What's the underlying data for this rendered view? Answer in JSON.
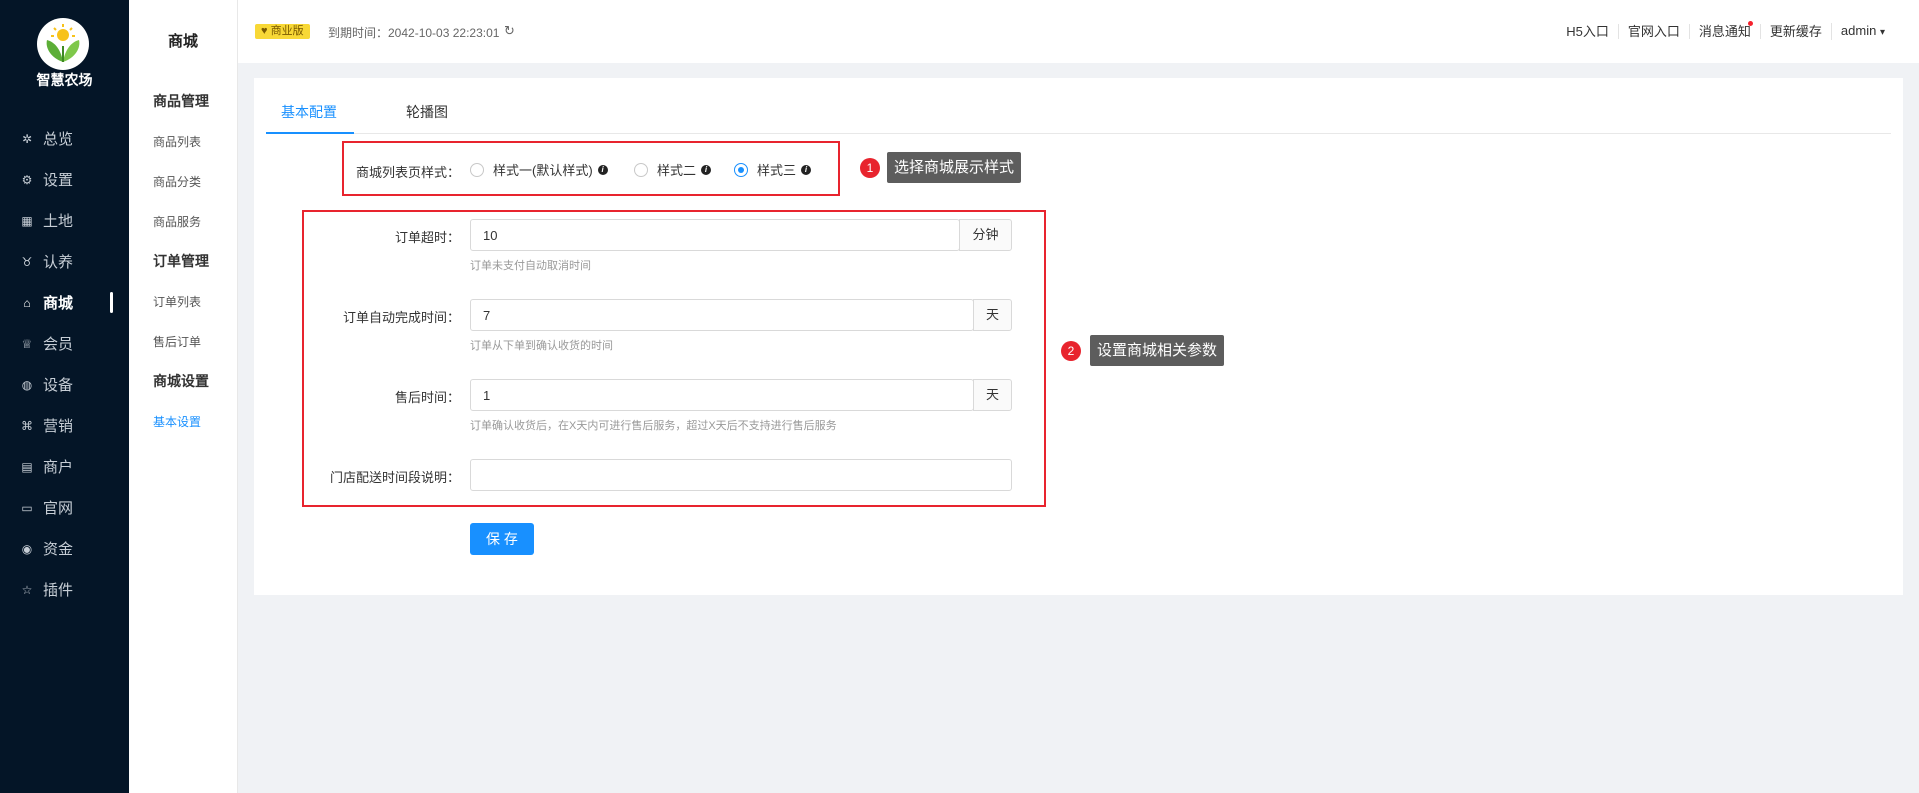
{
  "app": {
    "name": "智慧农场"
  },
  "nav": [
    {
      "icon": "dashboard-icon",
      "glyph": "✲",
      "label": "总览",
      "active": false
    },
    {
      "icon": "settings-icon",
      "glyph": "⚙",
      "label": "设置",
      "active": false
    },
    {
      "icon": "land-icon",
      "glyph": "▦",
      "label": "土地",
      "active": false
    },
    {
      "icon": "adopt-icon",
      "glyph": "♉",
      "label": "认养",
      "active": false
    },
    {
      "icon": "shop-icon",
      "glyph": "⌂",
      "label": "商城",
      "active": true
    },
    {
      "icon": "member-icon",
      "glyph": "♕",
      "label": "会员",
      "active": false
    },
    {
      "icon": "device-icon",
      "glyph": "◍",
      "label": "设备",
      "active": false
    },
    {
      "icon": "marketing-icon",
      "glyph": "⌘",
      "label": "营销",
      "active": false
    },
    {
      "icon": "merchant-icon",
      "glyph": "▤",
      "label": "商户",
      "active": false
    },
    {
      "icon": "website-icon",
      "glyph": "▭",
      "label": "官网",
      "active": false
    },
    {
      "icon": "funds-icon",
      "glyph": "◉",
      "label": "资金",
      "active": false
    },
    {
      "icon": "plugin-icon",
      "glyph": "☆",
      "label": "插件",
      "active": false
    }
  ],
  "subnav": {
    "title": "商城",
    "groups": [
      {
        "label": "商品管理",
        "items": [
          "商品列表",
          "商品分类",
          "商品服务"
        ]
      },
      {
        "label": "订单管理",
        "items": [
          "订单列表",
          "售后订单"
        ]
      },
      {
        "label": "商城设置",
        "items": [
          "基本设置"
        ]
      }
    ],
    "active_item": "基本设置"
  },
  "topbar": {
    "edition": "商业版",
    "expire": "到期时间：2042-10-03 22:23:01",
    "links": [
      "H5入口",
      "官网入口",
      "消息通知",
      "更新缓存",
      "admin"
    ],
    "user_caret": "▾"
  },
  "tabs": [
    "基本配置",
    "轮播图"
  ],
  "form": {
    "style_label": "商城列表页样式：",
    "style_options": [
      "样式一(默认样式)",
      "样式二",
      "样式三"
    ],
    "style_selected": 2,
    "order_timeout": {
      "label": "订单超时：",
      "value": "10",
      "unit": "分钟",
      "hint": "订单未支付自动取消时间"
    },
    "order_complete": {
      "label": "订单自动完成时间：",
      "value": "7",
      "unit": "天",
      "hint": "订单从下单到确认收货的时间"
    },
    "after_sale": {
      "label": "售后时间：",
      "value": "1",
      "unit": "天",
      "hint": "订单确认收货后，在X天内可进行售后服务，超过X天后不支持进行售后服务"
    },
    "delivery_desc": {
      "label": "门店配送时间段说明：",
      "value": ""
    },
    "save": "保 存"
  },
  "annotations": [
    {
      "num": "1",
      "text": "选择商城展示样式"
    },
    {
      "num": "2",
      "text": "设置商城相关参数"
    }
  ],
  "colors": {
    "primary": "#1890ff",
    "sidebar": "#041527",
    "annotation_red": "#e8242e"
  }
}
